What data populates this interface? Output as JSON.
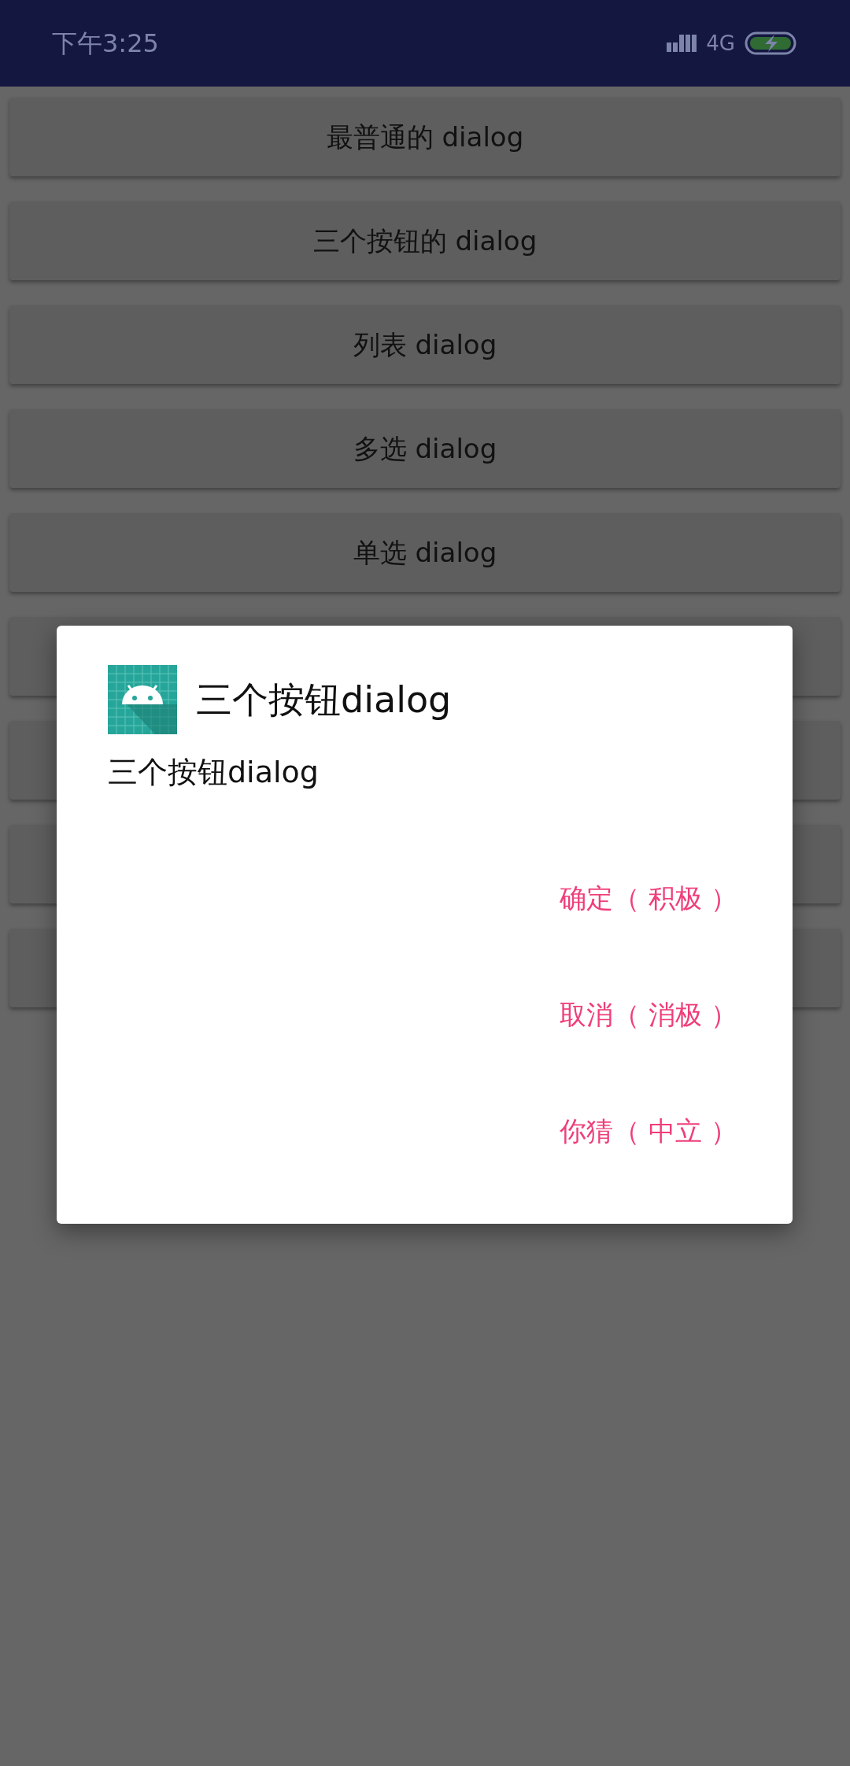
{
  "status_bar": {
    "time": "下午3:25",
    "network": "4G"
  },
  "buttons": [
    {
      "kind": "labeled",
      "label": "最普通的 dialog"
    },
    {
      "kind": "labeled",
      "label": "三个按钮的 dialog"
    },
    {
      "kind": "labeled",
      "label": "列表 dialog"
    },
    {
      "kind": "labeled",
      "label": "多选 dialog"
    },
    {
      "kind": "labeled",
      "label": "单选 dialog"
    },
    {
      "kind": "covered"
    },
    {
      "kind": "covered"
    },
    {
      "kind": "covered"
    },
    {
      "kind": "covered"
    }
  ],
  "dialog": {
    "title": "三个按钮dialog",
    "message": "三个按钮dialog",
    "actions": [
      "确定（ 积极 ）",
      "取消（ 消极 ）",
      "你猜（ 中立 ）"
    ]
  }
}
